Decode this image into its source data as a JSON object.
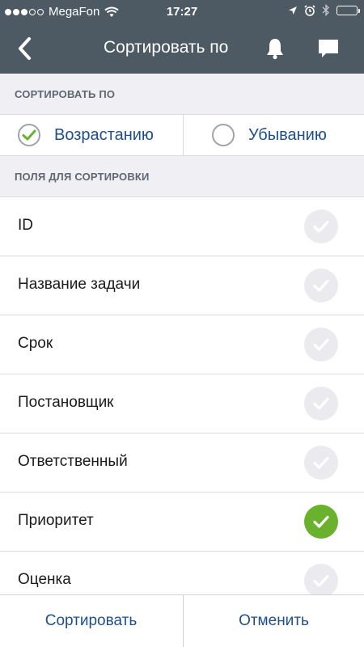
{
  "status_bar": {
    "carrier": "MegaFon",
    "time": "17:27"
  },
  "navbar": {
    "title": "Сортировать по",
    "back_icon": "chevron-left-icon",
    "bell_icon": "bell-icon",
    "chat_icon": "chat-bubble-icon"
  },
  "sort_section": {
    "header": "СОРТИРОВАТЬ ПО",
    "options": [
      {
        "label": "Возрастанию",
        "selected": true
      },
      {
        "label": "Убыванию",
        "selected": false
      }
    ]
  },
  "fields_section": {
    "header": "ПОЛЯ ДЛЯ СОРТИРОВКИ",
    "items": [
      {
        "label": "ID",
        "checked": false
      },
      {
        "label": "Название задачи",
        "checked": false
      },
      {
        "label": "Срок",
        "checked": false
      },
      {
        "label": "Постановщик",
        "checked": false
      },
      {
        "label": "Ответственный",
        "checked": false
      },
      {
        "label": "Приоритет",
        "checked": true
      },
      {
        "label": "Оценка",
        "checked": false
      }
    ]
  },
  "bottom_bar": {
    "sort_label": "Сортировать",
    "cancel_label": "Отменить"
  },
  "colors": {
    "navbar_bg": "#4d5a64",
    "accent_text": "#1f4f8b",
    "check_on": "#6ab22e",
    "check_off": "#ebebef"
  }
}
